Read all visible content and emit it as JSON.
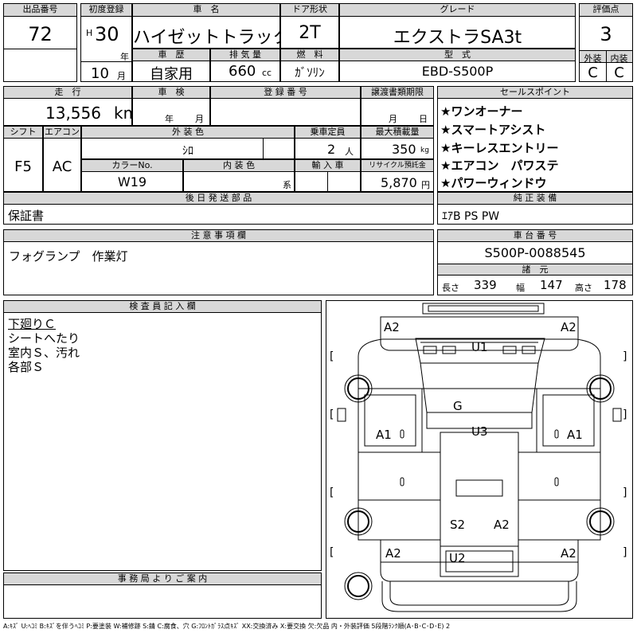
{
  "sheet": {
    "lot_no": {
      "label": "出品番号",
      "value": "72"
    },
    "first_reg": {
      "label": "初度登録",
      "era": "H",
      "year": "30",
      "year_unit": "年",
      "month": "10",
      "month_unit": "月"
    },
    "car_name": {
      "label": "車　名",
      "value": "ハイゼットトラック"
    },
    "door_type": {
      "label": "ドア形状",
      "value": "2T"
    },
    "grade": {
      "label": "グレード",
      "value": "エクストラSA3t"
    },
    "score": {
      "label": "評価点",
      "value": "3"
    },
    "history": {
      "label": "車　歴",
      "value": "自家用"
    },
    "displacement": {
      "label": "排 気 量",
      "value": "660",
      "unit": "cc"
    },
    "fuel": {
      "label": "燃　料",
      "value": "ｶﾞｿﾘﾝ"
    },
    "model": {
      "label": "型　式",
      "value": "EBD-S500P"
    },
    "exterior_grade": {
      "label": "外装",
      "value": "C"
    },
    "interior_grade": {
      "label": "内装",
      "value": "C"
    },
    "mileage": {
      "label": "走　行",
      "value": "13,556",
      "unit": "km"
    },
    "inspection": {
      "label": "車　検",
      "year_unit": "年",
      "month_unit": "月"
    },
    "reg_no": {
      "label": "登 録 番 号"
    },
    "transfer": {
      "label": "譲渡書類期限",
      "month_unit": "月",
      "day_unit": "日"
    },
    "sales_points": {
      "label": "セールスポイント",
      "items": [
        "★ワンオーナー",
        "★スマートアシスト",
        "★キーレスエントリー",
        "★エアコン　パワステ",
        "★パワーウィンドウ"
      ]
    },
    "shift": {
      "label": "シフト",
      "value": "F5"
    },
    "aircon": {
      "label": "エアコン",
      "value": "AC"
    },
    "ext_color": {
      "label": "外 装 色",
      "value": "ｼﾛ"
    },
    "capacity": {
      "label": "乗車定員",
      "value": "2",
      "unit": "人"
    },
    "max_load": {
      "label": "最大積載量",
      "value": "350",
      "unit": "kg"
    },
    "color_no": {
      "label": "カラーNo.",
      "value": "W19"
    },
    "int_color": {
      "label": "内 装 色",
      "unit": "系"
    },
    "import": {
      "label": "輸 入 車"
    },
    "recycle": {
      "label": "リサイクル預託金",
      "value": "5,870",
      "unit": "円"
    },
    "later_parts": {
      "label": "後 日 発 送 部 品",
      "value": "保証書"
    },
    "genuine_equip": {
      "label": "純 正 装 備",
      "value": "ｴｱB PS PW"
    },
    "notes": {
      "label": "注 意 事 項 欄",
      "value": "フォグランプ　作業灯"
    },
    "chassis_no": {
      "label": "車 台 番 号",
      "value": "S500P-0088545"
    },
    "dims": {
      "label": "諸　元",
      "len_label": "長さ",
      "len": "339",
      "wid_label": "幅",
      "wid": "147",
      "hgt_label": "高さ",
      "hgt": "178"
    },
    "inspector": {
      "label": "検 査 員 記 入 欄",
      "lines": [
        "下廻りＣ",
        "シートへたり",
        "室内Ｓ、汚れ",
        "各部Ｓ"
      ]
    },
    "office": {
      "label": "事 務 局 よ り ご 案 内"
    },
    "legend": "A:ｷｽﾞ U:ﾍｺﾐ B:ｷｽﾞを伴うﾍｺﾐ P:要塗装 W:補修跡 S:錆 C:腐食、穴 G:ﾌﾛﾝﾄｶﾞﾗｽ点ｷｽﾞ XX:交換済み X:要交換 欠:欠品 内・外装評価 5段階ﾗﾝｸ順(A･B･C･D･E) 2"
  },
  "diagram_marks": [
    {
      "text": "A2"
    },
    {
      "text": "A2"
    },
    {
      "text": "U1"
    },
    {
      "text": "G"
    },
    {
      "text": "U3"
    },
    {
      "text": "A1"
    },
    {
      "text": "A1"
    },
    {
      "text": "S2"
    },
    {
      "text": "A2"
    },
    {
      "text": "U2"
    },
    {
      "text": "A2"
    },
    {
      "text": "A2"
    }
  ],
  "diagram_brackets": [
    "[",
    "]",
    "[",
    "]",
    "[",
    "]",
    "[",
    "]"
  ]
}
